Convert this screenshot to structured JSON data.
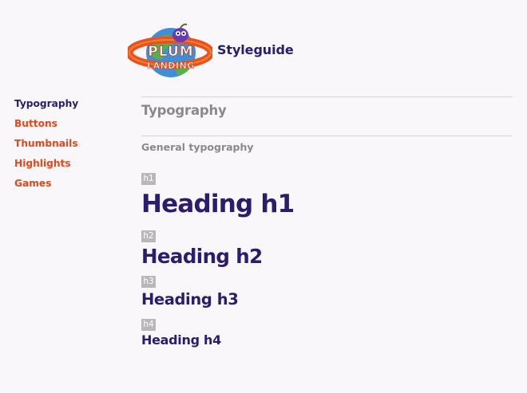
{
  "header": {
    "logo_text_top": "PLUM",
    "logo_text_bottom": "LANDING",
    "site_title": "Styleguide"
  },
  "sidebar": {
    "items": [
      {
        "label": "Typography",
        "active": true
      },
      {
        "label": "Buttons",
        "active": false
      },
      {
        "label": "Thumbnails",
        "active": false
      },
      {
        "label": "Highlights",
        "active": false
      },
      {
        "label": "Games",
        "active": false
      }
    ]
  },
  "main": {
    "section_title": "Typography",
    "subsection_title": "General typography",
    "samples": [
      {
        "tag": "h1",
        "text": "Heading h1"
      },
      {
        "tag": "h2",
        "text": "Heading h2"
      },
      {
        "tag": "h3",
        "text": "Heading h3"
      },
      {
        "tag": "h4",
        "text": "Heading h4"
      }
    ]
  },
  "colors": {
    "background": "#f9f7f9",
    "brand_purple": "#2d1b6e",
    "link_orange": "#e0491b",
    "muted_gray": "#8a8a8a",
    "tag_gray": "#b8b8b8"
  }
}
